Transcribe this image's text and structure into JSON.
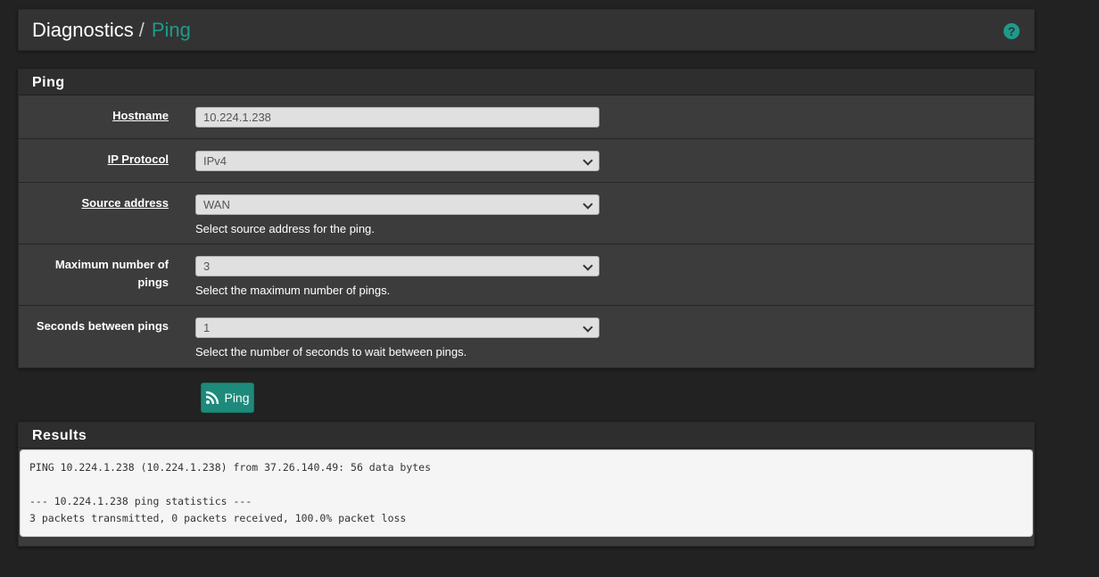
{
  "breadcrumb": {
    "parent": "Diagnostics",
    "separator": "/",
    "current": "Ping"
  },
  "help_icon": "question-circle-icon",
  "ping_panel": {
    "title": "Ping",
    "hostname": {
      "label": "Hostname",
      "value": "10.224.1.238"
    },
    "ip_protocol": {
      "label": "IP Protocol",
      "value": "IPv4"
    },
    "source_address": {
      "label": "Source address",
      "value": "WAN",
      "help": "Select source address for the ping."
    },
    "max_pings": {
      "label": "Maximum number of pings",
      "value": "3",
      "help": "Select the maximum number of pings."
    },
    "seconds_between": {
      "label": "Seconds between pings",
      "value": "1",
      "help": "Select the number of seconds to wait between pings."
    }
  },
  "ping_button": {
    "label": "Ping",
    "icon": "rss-icon"
  },
  "results_panel": {
    "title": "Results",
    "lines": [
      "PING 10.224.1.238 (10.224.1.238) from 37.26.140.49: 56 data bytes",
      "",
      "--- 10.224.1.238 ping statistics ---",
      "3 packets transmitted, 0 packets received, 100.0% packet loss"
    ]
  },
  "colors": {
    "accent": "#1e9a8a",
    "button": "#1e8a7b",
    "background": "#222222",
    "panel": "#3c3c3c"
  }
}
